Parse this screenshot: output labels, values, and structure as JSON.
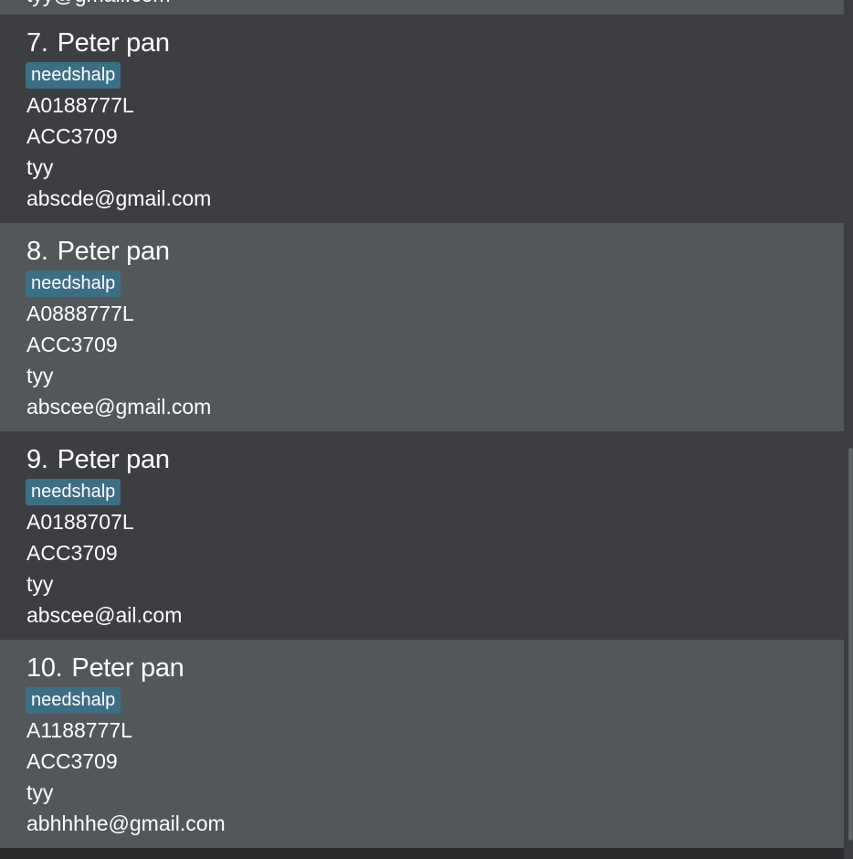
{
  "partial_card": {
    "email": "tyy@gmail.com"
  },
  "persons": [
    {
      "index": "7.",
      "name": "Peter pan",
      "tag": "needshalp",
      "student_id": "A0188777L",
      "module": "ACC3709",
      "tutorial": "tyy",
      "email": "abscde@gmail.com"
    },
    {
      "index": "8.",
      "name": "Peter pan",
      "tag": "needshalp",
      "student_id": "A0888777L",
      "module": "ACC3709",
      "tutorial": "tyy",
      "email": "abscee@gmail.com"
    },
    {
      "index": "9.",
      "name": "Peter pan",
      "tag": "needshalp",
      "student_id": "A0188707L",
      "module": "ACC3709",
      "tutorial": "tyy",
      "email": "abscee@ail.com"
    },
    {
      "index": "10.",
      "name": "Peter pan",
      "tag": "needshalp",
      "student_id": "A1188777L",
      "module": "ACC3709",
      "tutorial": "tyy",
      "email": "abhhhhe@gmail.com"
    }
  ],
  "colors": {
    "card_dark": "#3c3e41",
    "card_light": "#52575a",
    "tag_bg": "#3d6f84",
    "text": "#ffffff"
  }
}
